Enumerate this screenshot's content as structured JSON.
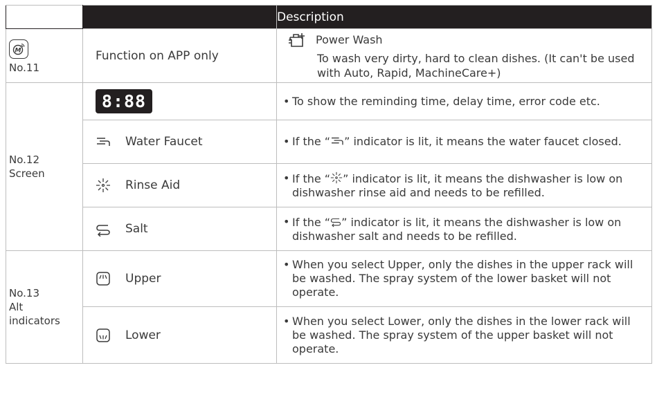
{
  "header": {
    "col1": "",
    "col2": "",
    "col3": "Description"
  },
  "row11": {
    "label": "No.11",
    "function": "Function on APP only",
    "feature_name": "Power Wash",
    "feature_desc": "To wash very dirty, hard to clean dishes. (It can't be used with Auto, Rapid, MachineCare+)"
  },
  "row12": {
    "label_line1": "No.12",
    "label_line2": "Screen",
    "display_text": "8:88",
    "display_desc": "To show the reminding time, delay time, error code etc.",
    "faucet_name": "Water Faucet",
    "faucet_desc_a": "If the “",
    "faucet_desc_b": "” indicator is lit, it means the water faucet closed.",
    "rinse_name": "Rinse Aid",
    "rinse_desc_a": "If the “",
    "rinse_desc_b": "” indicator is lit, it means the dishwasher is low on dishwasher rinse aid and needs to be refilled.",
    "salt_name": "Salt",
    "salt_desc_a": "If the “",
    "salt_desc_b": "” indicator is lit, it means the dishwasher is low on dishwasher salt and needs to be refilled."
  },
  "row13": {
    "label_line1": "No.13",
    "label_line2": "Alt",
    "label_line3": "indicators",
    "upper_name": "Upper",
    "upper_desc": "When you select Upper, only the dishes in the upper rack will be washed. The spray system of the lower basket will not operate.",
    "lower_name": "Lower",
    "lower_desc": "When you select Lower, only the dishes in the lower rack will be washed. The spray system of the upper basket will not operate."
  },
  "bullet_symbol": "•",
  "icons": [
    "app-icon",
    "power-wash-icon",
    "display-icon",
    "water-faucet-icon",
    "rinse-aid-icon",
    "salt-icon",
    "upper-rack-icon",
    "lower-rack-icon"
  ]
}
